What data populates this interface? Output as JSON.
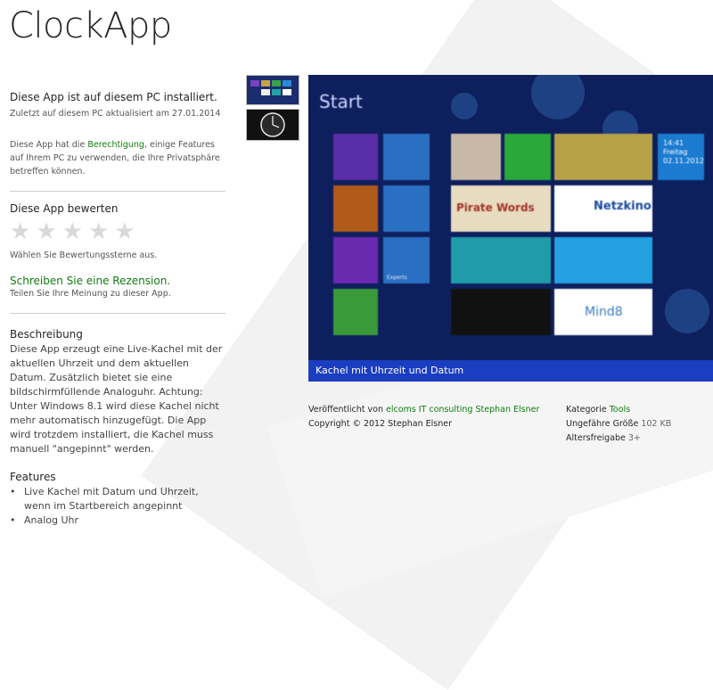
{
  "app": {
    "title": "ClockApp"
  },
  "install": {
    "title": "Diese App ist auf diesem PC installiert.",
    "updated": "Zuletzt auf diesem PC aktualisiert am 27.01.2014",
    "permission_pre": "Diese App hat die ",
    "permission_link": "Berechtigung",
    "permission_post": ", einige Features auf Ihrem PC zu verwenden, die Ihre Privatsphäre betreffen können."
  },
  "rating": {
    "title": "Diese App bewerten",
    "hint": "Wählen Sie Bewertungssterne aus.",
    "star_glyph": "★",
    "stars_selected": 0,
    "stars_total": 5
  },
  "review": {
    "link": "Schreiben Sie eine Rezension.",
    "hint": "Teilen Sie Ihre Meinung zu dieser App."
  },
  "description": {
    "title": "Beschreibung",
    "text": "Diese App erzeugt eine Live-Kachel mit der aktuellen Uhrzeit und dem aktuellen Datum. Zusätzlich bietet sie eine bildschirmfüllende Analoguhr. Achtung: Unter Windows 8.1 wird diese Kachel nicht mehr automatisch hinzugefügt. Die App wird trotzdem installiert, die Kachel muss manuell \"angepinnt\" werden."
  },
  "features": {
    "title": "Features",
    "items": [
      "Live Kachel mit Datum und Uhrzeit, wenn im Startbereich angepinnt",
      "Analog Uhr"
    ]
  },
  "screenshot": {
    "start_text": "Start",
    "caption": "Kachel mit Uhrzeit und Datum",
    "clock_time": "14:41",
    "clock_day": "Freitag",
    "clock_date": "02.11.2012",
    "tile_netzkino": "Netzkino",
    "tile_mind8": "Mind8",
    "tile_piratewords": "Pirate Words",
    "tile_experts": "Experts"
  },
  "meta": {
    "published_label": "Veröffentlicht von ",
    "publisher": "elcoms IT consulting Stephan Elsner",
    "copyright": "Copyright © 2012 Stephan Elsner",
    "category_label": "Kategorie ",
    "category": "Tools",
    "size_label": "Ungefähre Größe ",
    "size": "102 KB",
    "age_label": "Altersfreigabe ",
    "age": "3+"
  },
  "colors": {
    "link_green": "#107c10",
    "start_blue": "#0e1f5e",
    "caption_blue": "#1b3dbf"
  }
}
